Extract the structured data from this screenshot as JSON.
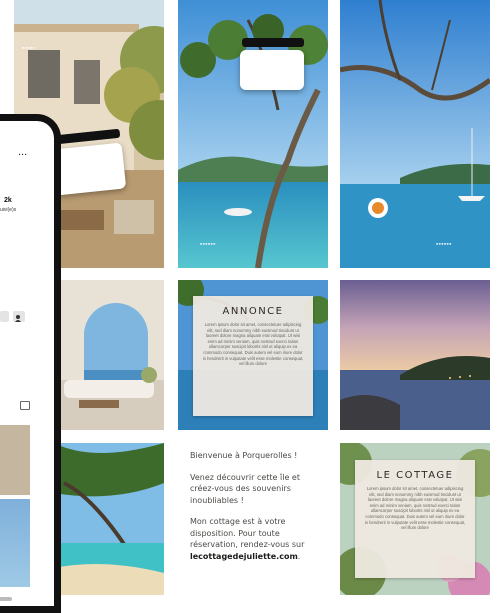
{
  "annonce_card": {
    "title": "ANNONCE",
    "body": "Lorem ipsum dolor sit amet, consectetuer adipiscing elit, sed diam nonummy nibh euismod tincidunt ut laoreet dolore magna aliquam erat volutpat. Ut wisi enim ad minim veniam, quis nostrud exerci tation ullamcorper suscipit lobortis nisl ut aliquip ex ea commodo consequat. Duis autem vel eum iriure dolor in hendrerit in vulputate velit esse molestie consequat, vel illum dolore"
  },
  "cottage_card": {
    "title": "LE COTTAGE",
    "body": "Lorem ipsum dolor sit amet, consectetuer adipiscing elit, sed diam nonummy nibh euismod tincidunt ut laoreet dolore magna aliquam erat volutpat. Ut wisi enim ad minim veniam, quis nostrud exerci tation ullamcorper suscipit lobortis nisl ut aliquip ex ea commodo consequat. Duis autem vel eum iriure dolor in hendrerit in vulputate velit esse molestie consequat, vel illum dolore"
  },
  "welcome_text": {
    "line1": "Bienvenue à Porquerolles !",
    "line2": "Venez découvrir cette île et créez-vous des souvenirs inoubliables !",
    "line3_prefix": "Mon cottage est à votre disposition. Pour toute réservation, rendez-vous sur",
    "link": "lecottagedejuliette.com",
    "line3_suffix": "."
  },
  "phone_profile": {
    "menu": "...",
    "followers_count": "2k",
    "followers_label": "uivi(e)s"
  },
  "colors": {
    "sea": "#1d86c4",
    "sky": "#5aa7e0",
    "card": "#eee9e0",
    "text": "#4d4a46"
  }
}
